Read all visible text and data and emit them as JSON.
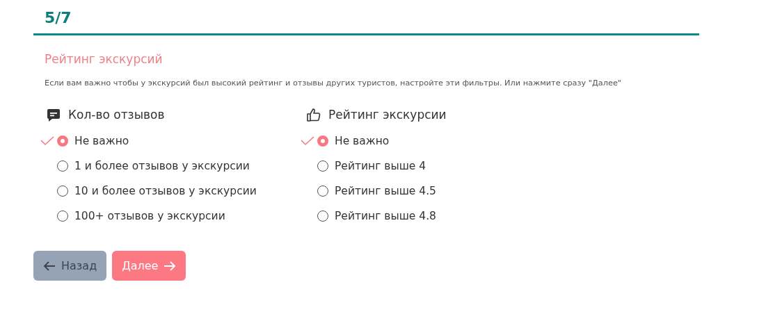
{
  "step": "5/7",
  "title": "Рейтинг экскурсий",
  "description": "Если вам важно чтобы у экскурсий был высокий рейтинг и отзывы других туристов, настройте эти фильтры. Или нажмите сразу \"Далее\"",
  "groups": [
    {
      "kind": "comments",
      "heading": "Кол-во отзывов",
      "options": [
        {
          "label": "Не важно",
          "selected": true
        },
        {
          "label": "1 и более отзывов у экскурсии",
          "selected": false
        },
        {
          "label": "10 и более отзывов у экскурсии",
          "selected": false
        },
        {
          "label": "100+ отзывов у экскурсии",
          "selected": false
        }
      ]
    },
    {
      "kind": "rating",
      "heading": "Рейтинг экскурсии",
      "options": [
        {
          "label": "Не важно",
          "selected": true
        },
        {
          "label": "Рейтинг выше 4",
          "selected": false
        },
        {
          "label": "Рейтинг выше 4.5",
          "selected": false
        },
        {
          "label": "Рейтинг выше 4.8",
          "selected": false
        }
      ]
    }
  ],
  "buttons": [
    {
      "kind": "back",
      "label": "Назад"
    },
    {
      "kind": "next",
      "label": "Далее"
    }
  ]
}
